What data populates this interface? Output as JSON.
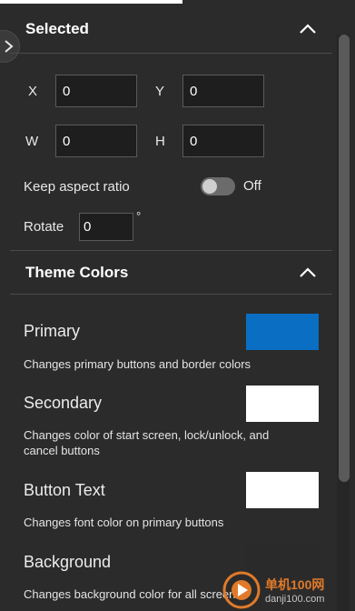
{
  "selected": {
    "title": "Selected",
    "x_label": "X",
    "x_value": "0",
    "y_label": "Y",
    "y_value": "0",
    "w_label": "W",
    "w_value": "0",
    "h_label": "H",
    "h_value": "0",
    "aspect_label": "Keep aspect ratio",
    "aspect_state": "Off",
    "rotate_label": "Rotate",
    "rotate_value": "0",
    "rotate_unit": "°"
  },
  "theme": {
    "title": "Theme Colors",
    "colors": [
      {
        "name": "Primary",
        "description": "Changes primary buttons and border colors",
        "color": "#0a6fc2"
      },
      {
        "name": "Secondary",
        "description": "Changes color of start screen, lock/unlock, and cancel buttons",
        "color": "#ffffff"
      },
      {
        "name": "Button Text",
        "description": "Changes font color on primary buttons",
        "color": "#ffffff"
      },
      {
        "name": "Background",
        "description": "Changes background color for all screen",
        "color": "#2a2a2a"
      }
    ]
  },
  "watermark": {
    "line1": "单机100网",
    "line2": "danji100.com"
  },
  "icons": [
    "chevron-right-icon",
    "chevron-up-icon",
    "watermark-logo-icon"
  ]
}
